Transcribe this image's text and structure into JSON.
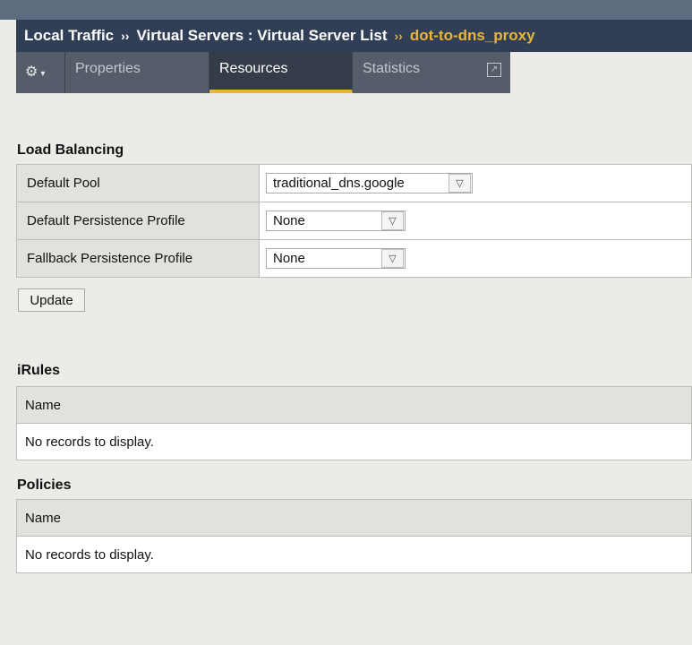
{
  "breadcrumb": {
    "part1": "Local Traffic",
    "sep": "››",
    "part2": "Virtual Servers : Virtual Server List",
    "current": "dot-to-dns_proxy"
  },
  "tabs": {
    "gear_icon": "gear-icon",
    "properties": "Properties",
    "resources": "Resources",
    "statistics": "Statistics",
    "external_icon": "external-link-icon"
  },
  "load_balancing": {
    "title": "Load Balancing",
    "rows": [
      {
        "label": "Default Pool",
        "value": "traditional_dns.google"
      },
      {
        "label": "Default Persistence Profile",
        "value": "None"
      },
      {
        "label": "Fallback Persistence Profile",
        "value": "None"
      }
    ],
    "update_label": "Update"
  },
  "irules": {
    "title": "iRules",
    "column": "Name",
    "empty": "No records to display."
  },
  "policies": {
    "title": "Policies",
    "column": "Name",
    "empty": "No records to display."
  },
  "colors": {
    "header_bg": "#303f56",
    "accent": "#e8b53c",
    "tab_bg": "#545d69",
    "active_tab_bg": "#333c48",
    "page_bg": "#ecebe7"
  }
}
